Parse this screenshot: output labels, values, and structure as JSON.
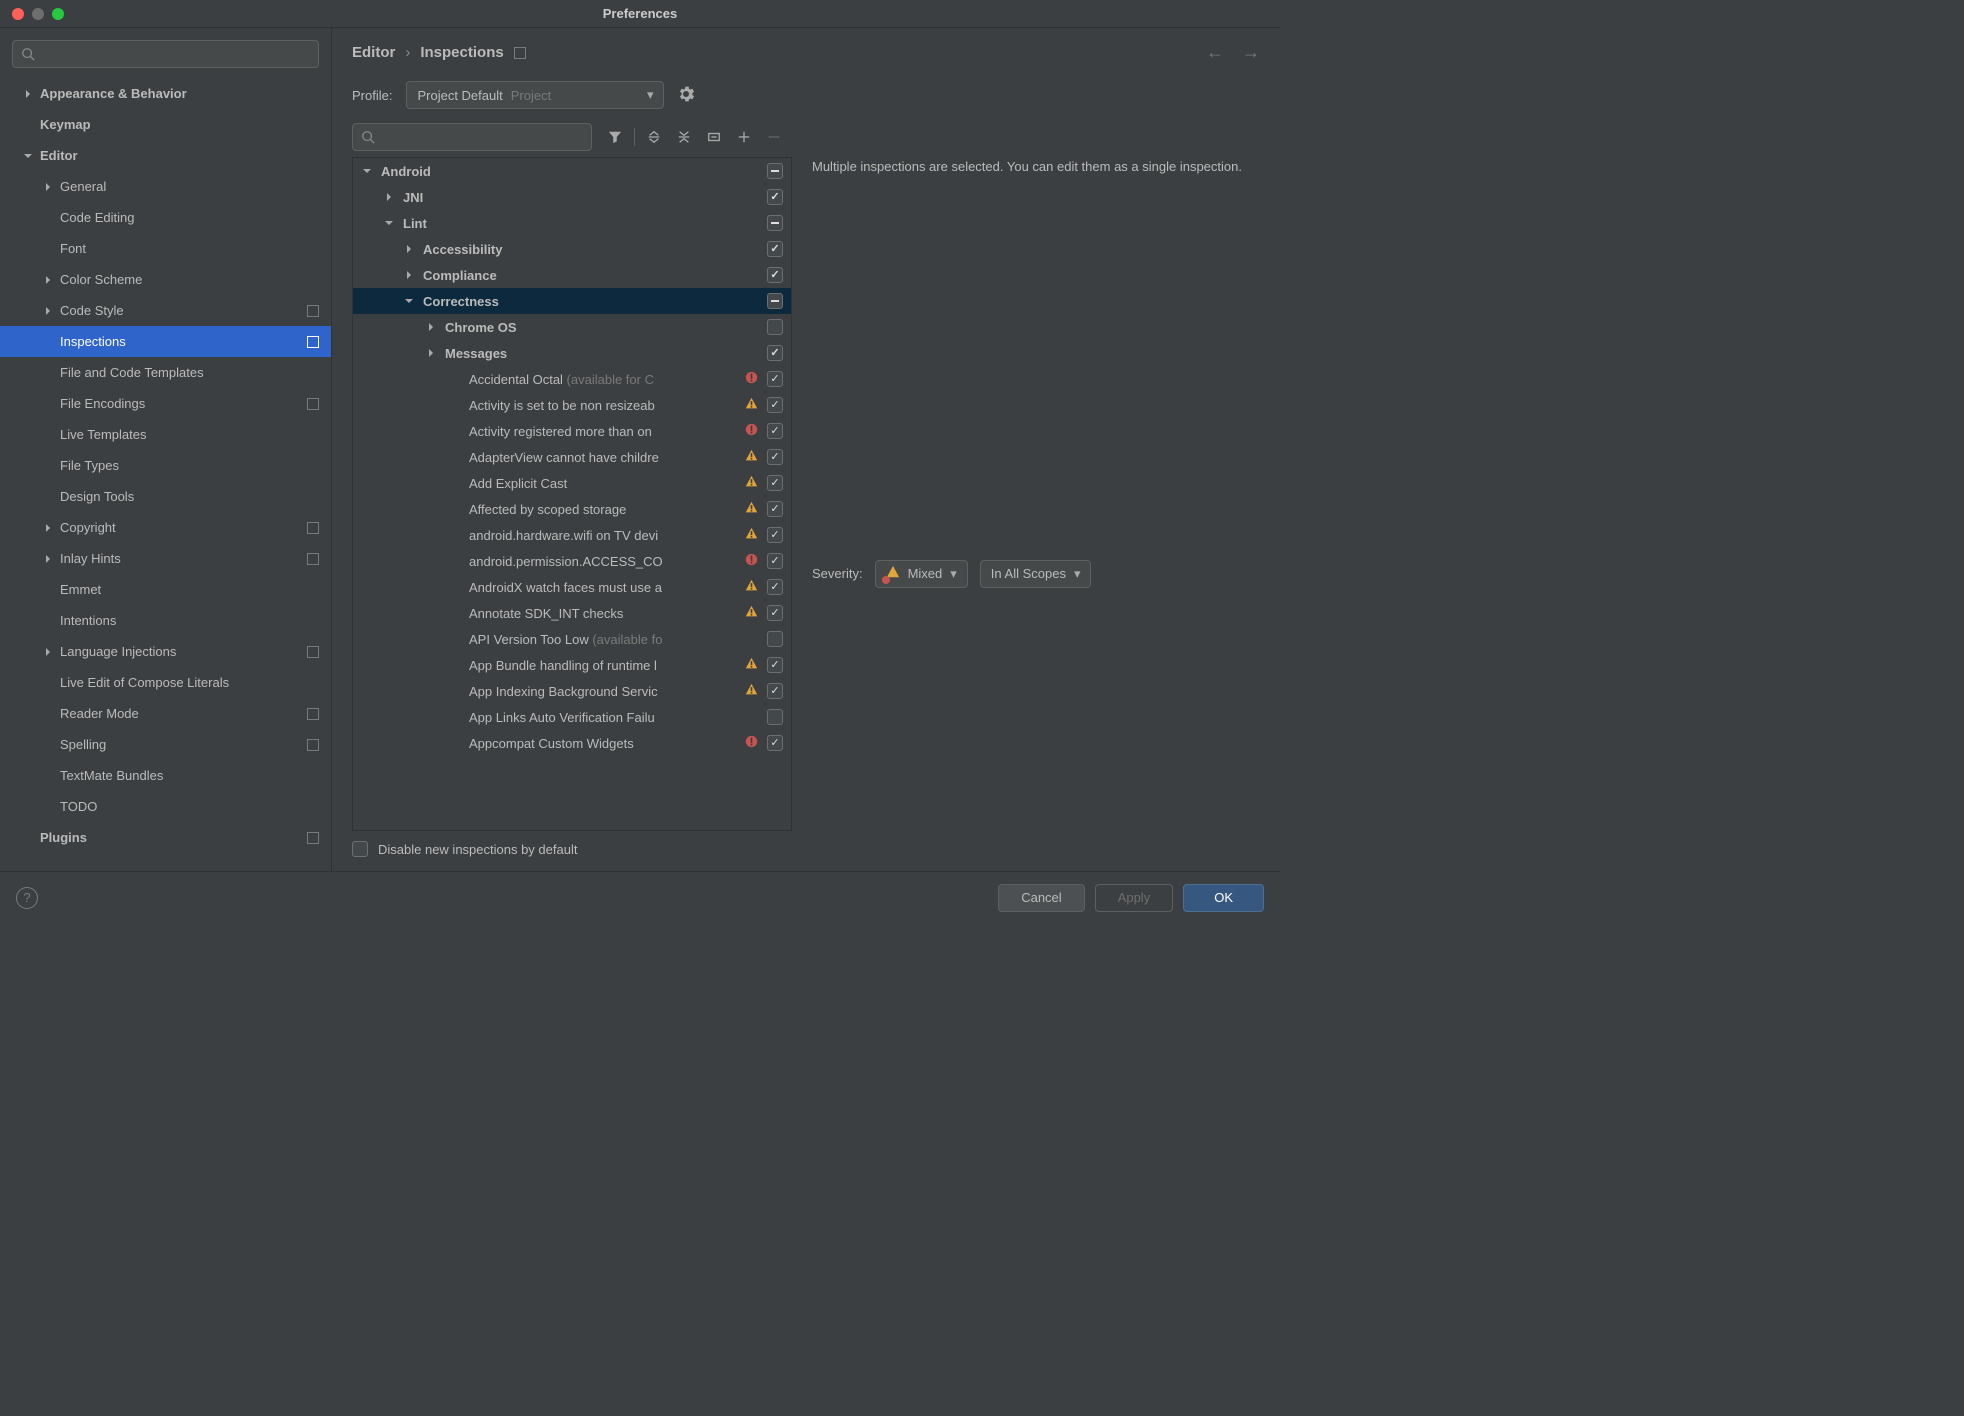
{
  "window": {
    "title": "Preferences"
  },
  "sidebar": {
    "search_placeholder": "",
    "items": [
      {
        "label": "Appearance & Behavior",
        "level": 1,
        "bold": true,
        "chev": "right"
      },
      {
        "label": "Keymap",
        "level": 1,
        "bold": true
      },
      {
        "label": "Editor",
        "level": 1,
        "bold": true,
        "chev": "down"
      },
      {
        "label": "General",
        "level": 2,
        "chev": "right"
      },
      {
        "label": "Code Editing",
        "level": 2
      },
      {
        "label": "Font",
        "level": 2
      },
      {
        "label": "Color Scheme",
        "level": 2,
        "chev": "right"
      },
      {
        "label": "Code Style",
        "level": 2,
        "chev": "right",
        "proj": true
      },
      {
        "label": "Inspections",
        "level": 2,
        "selected": true,
        "proj": true
      },
      {
        "label": "File and Code Templates",
        "level": 2
      },
      {
        "label": "File Encodings",
        "level": 2,
        "proj": true
      },
      {
        "label": "Live Templates",
        "level": 2
      },
      {
        "label": "File Types",
        "level": 2
      },
      {
        "label": "Design Tools",
        "level": 2
      },
      {
        "label": "Copyright",
        "level": 2,
        "chev": "right",
        "proj": true
      },
      {
        "label": "Inlay Hints",
        "level": 2,
        "chev": "right",
        "proj": true
      },
      {
        "label": "Emmet",
        "level": 2
      },
      {
        "label": "Intentions",
        "level": 2
      },
      {
        "label": "Language Injections",
        "level": 2,
        "chev": "right",
        "proj": true
      },
      {
        "label": "Live Edit of Compose Literals",
        "level": 2
      },
      {
        "label": "Reader Mode",
        "level": 2,
        "proj": true
      },
      {
        "label": "Spelling",
        "level": 2,
        "proj": true
      },
      {
        "label": "TextMate Bundles",
        "level": 2
      },
      {
        "label": "TODO",
        "level": 2
      },
      {
        "label": "Plugins",
        "level": 1,
        "bold": true,
        "proj": true
      }
    ]
  },
  "breadcrumb": {
    "root": "Editor",
    "current": "Inspections"
  },
  "profile": {
    "label": "Profile:",
    "selected_name": "Project Default",
    "selected_scope": "Project"
  },
  "inspections": {
    "tree": [
      {
        "label": "Android",
        "level": 1,
        "bold": true,
        "chev": "down",
        "state": "mixed"
      },
      {
        "label": "JNI",
        "level": 2,
        "bold": true,
        "chev": "right",
        "state": "checked"
      },
      {
        "label": "Lint",
        "level": 2,
        "bold": true,
        "chev": "down",
        "state": "mixed"
      },
      {
        "label": "Accessibility",
        "level": 3,
        "bold": true,
        "chev": "right",
        "state": "checked"
      },
      {
        "label": "Compliance",
        "level": 3,
        "bold": true,
        "chev": "right",
        "state": "checked"
      },
      {
        "label": "Correctness",
        "level": 3,
        "bold": true,
        "chev": "down",
        "state": "mixed",
        "selected": true
      },
      {
        "label": "Chrome OS",
        "level": 4,
        "bold": true,
        "chev": "right",
        "state": "unchecked"
      },
      {
        "label": "Messages",
        "level": 4,
        "bold": true,
        "chev": "right",
        "state": "checked"
      },
      {
        "label": "Accidental Octal",
        "suffix": " (available for C",
        "level": 5,
        "state": "checked",
        "sev": "err"
      },
      {
        "label": "Activity is set to be non resizeab",
        "level": 5,
        "state": "checked",
        "sev": "warn"
      },
      {
        "label": "Activity registered more than on",
        "level": 5,
        "state": "checked",
        "sev": "err"
      },
      {
        "label": "AdapterView cannot have childre",
        "level": 5,
        "state": "checked",
        "sev": "warn"
      },
      {
        "label": "Add Explicit Cast",
        "level": 5,
        "state": "checked",
        "sev": "warn"
      },
      {
        "label": "Affected by scoped storage",
        "level": 5,
        "state": "checked",
        "sev": "warn"
      },
      {
        "label": "android.hardware.wifi on TV devi",
        "level": 5,
        "state": "checked",
        "sev": "warn"
      },
      {
        "label": "android.permission.ACCESS_CO",
        "level": 5,
        "state": "checked",
        "sev": "err"
      },
      {
        "label": "AndroidX watch faces must use a",
        "level": 5,
        "state": "checked",
        "sev": "warn"
      },
      {
        "label": "Annotate SDK_INT checks",
        "level": 5,
        "state": "checked",
        "sev": "warn"
      },
      {
        "label": "API Version Too Low",
        "suffix": " (available fo",
        "level": 5,
        "state": "unchecked"
      },
      {
        "label": "App Bundle handling of runtime l",
        "level": 5,
        "state": "checked",
        "sev": "warn"
      },
      {
        "label": "App Indexing Background Servic",
        "level": 5,
        "state": "checked",
        "sev": "warn"
      },
      {
        "label": "App Links Auto Verification Failu",
        "level": 5,
        "state": "unchecked"
      },
      {
        "label": "Appcompat Custom Widgets",
        "level": 5,
        "state": "checked",
        "sev": "err"
      }
    ]
  },
  "detail": {
    "text": "Multiple inspections are selected. You can edit them as a single inspection.",
    "severity_label": "Severity:",
    "severity_value": "Mixed",
    "scope_value": "In All Scopes"
  },
  "disable": {
    "label": "Disable new inspections by default"
  },
  "footer": {
    "cancel": "Cancel",
    "apply": "Apply",
    "ok": "OK"
  }
}
